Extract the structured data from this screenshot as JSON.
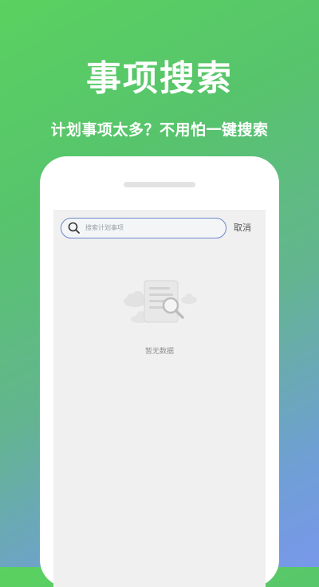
{
  "promo": {
    "title": "事项搜索",
    "subtitle": "计划事项太多？不用怕一键搜索"
  },
  "search": {
    "placeholder": "搜索计划事项",
    "cancel_label": "取消",
    "icon": "search-icon"
  },
  "empty_state": {
    "text": "暂无数据",
    "icon": "empty-document-search-illustration"
  },
  "colors": {
    "gradient_start": "#5ad160",
    "gradient_end": "#7898ea",
    "search_border": "#6f86cf",
    "screen_bg": "#f0f0f0"
  }
}
